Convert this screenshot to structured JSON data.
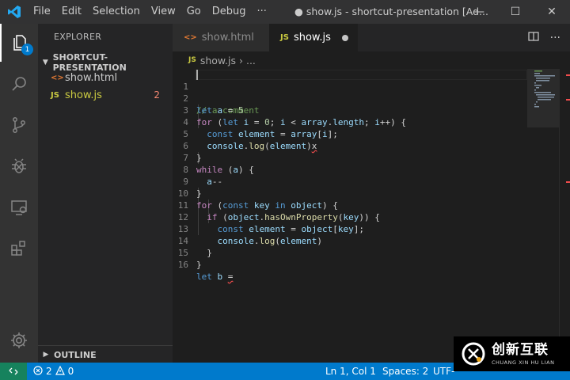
{
  "titlebar": {
    "menu": [
      "File",
      "Edit",
      "Selection",
      "View",
      "Go",
      "Debug",
      "···"
    ],
    "title": "● show.js - shortcut-presentation [Ad...",
    "controls": [
      "—",
      "☐",
      "✕"
    ]
  },
  "activitybar": {
    "badge": "1"
  },
  "sidebar": {
    "title": "EXPLORER",
    "section": "SHORTCUT-PRESENTATION",
    "files": [
      {
        "icon": "<>",
        "name": "show.html",
        "color": "#cccccc",
        "icon_color": "#e37933",
        "count": ""
      },
      {
        "icon": "JS",
        "name": "show.js",
        "color": "#cbcb41",
        "icon_color": "#cbcb41",
        "count": "2"
      }
    ],
    "outline": "OUTLINE"
  },
  "tabs": [
    {
      "icon": "<>",
      "label": "show.html"
    },
    {
      "icon": "JS",
      "label": "show.js"
    }
  ],
  "breadcrumb": {
    "icon": "JS",
    "file": "show.js",
    "sep": "›",
    "more": "..."
  },
  "editor": {
    "line_numbers": [
      "1",
      "2",
      "3",
      "4",
      "5",
      "6",
      "7",
      "8",
      "9",
      "10",
      "11",
      "12",
      "13",
      "14",
      "15",
      "16"
    ]
  },
  "statusbar": {
    "errors": "2",
    "warnings": "0",
    "position": "Ln 1, Col 1",
    "spaces": "Spaces: 2",
    "encoding": "UTF-"
  },
  "watermark": {
    "cn": "创新互联",
    "en": "CHUANG XIN HU LIAN"
  },
  "colors": {
    "accent": "#007acc",
    "remote": "#16825d",
    "error": "#f14c4c"
  }
}
